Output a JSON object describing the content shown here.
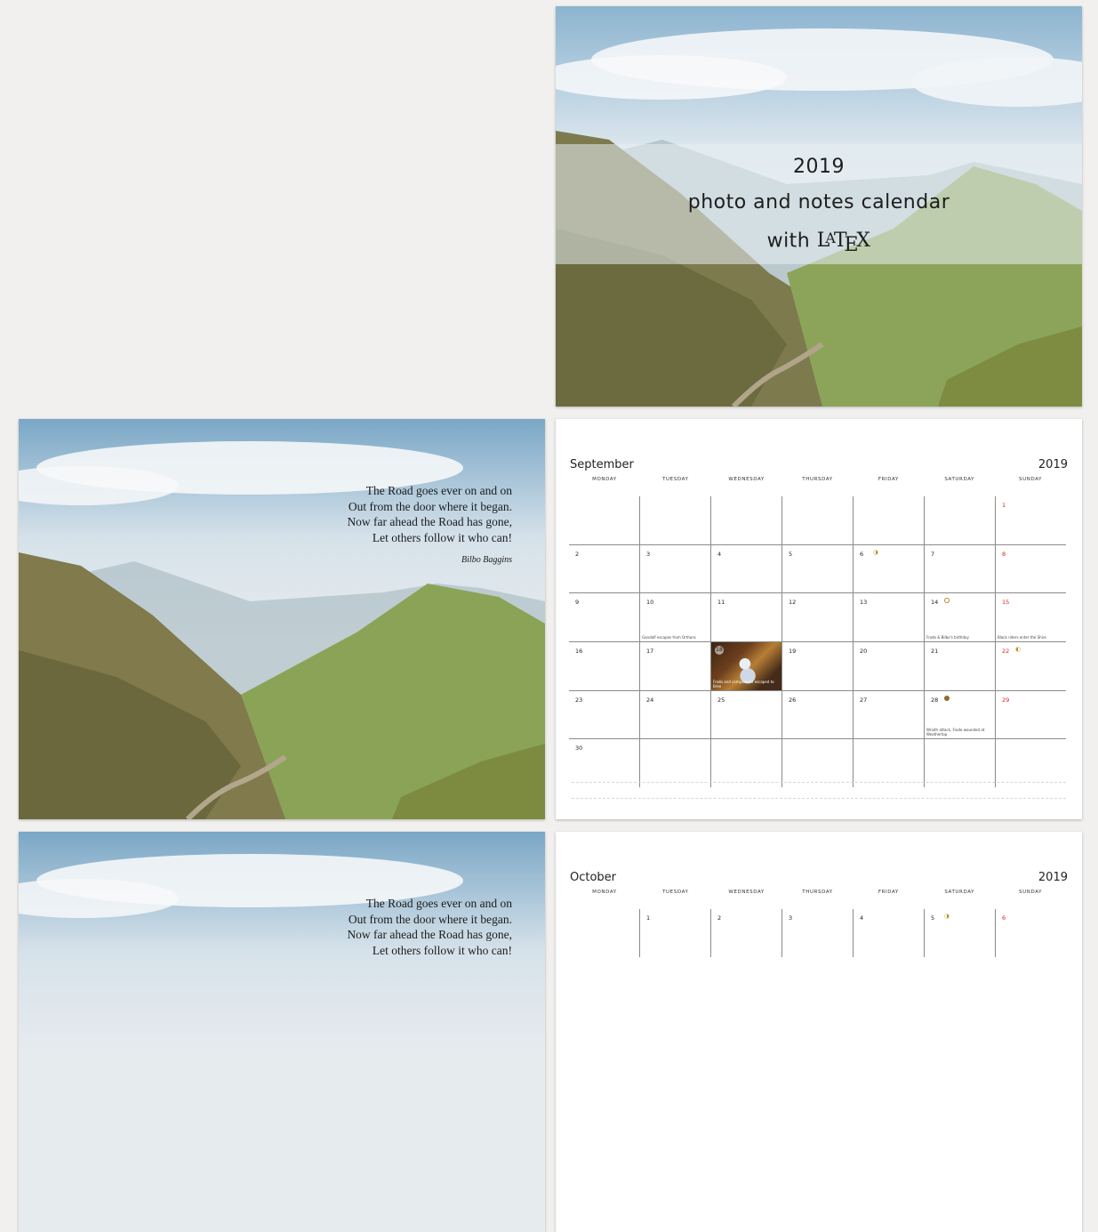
{
  "cover": {
    "year": "2019",
    "subtitle": "photo and notes calendar",
    "with_prefix": "with"
  },
  "poem": {
    "lines": [
      "The Road goes ever on and on",
      "Out from the door where it began.",
      "Now far ahead the Road has gone,",
      "Let others follow it who can!"
    ],
    "author": "Bilbo Baggins"
  },
  "weekdays": [
    "MONDAY",
    "TUESDAY",
    "WEDNESDAY",
    "THURSDAY",
    "FRIDAY",
    "SATURDAY",
    "SUNDAY"
  ],
  "colors": {
    "weekend_red": "#d8231f",
    "moon": "#b8862a",
    "background": "#f1f0ee"
  },
  "september": {
    "month": "September",
    "year": "2019",
    "weeks": [
      [
        "",
        "",
        "",
        "",
        "",
        "",
        "1"
      ],
      [
        "2",
        "3",
        "4",
        "5",
        "6",
        "7",
        "8"
      ],
      [
        "9",
        "10",
        "11",
        "12",
        "13",
        "14",
        "15"
      ],
      [
        "16",
        "17",
        "18",
        "19",
        "20",
        "21",
        "22"
      ],
      [
        "23",
        "24",
        "25",
        "26",
        "27",
        "28",
        "29"
      ],
      [
        "30",
        "",
        "",
        "",
        "",
        "",
        ""
      ]
    ],
    "notes": {
      "10": "Gandalf escapes from Orthanc",
      "14": "Frodo & Bilbo's birthday",
      "15": "Black riders enter the Shire",
      "18": "Frodo and companions escaped to Bree",
      "28": "Wraith attack, Frodo wounded at Weathertop"
    },
    "image_day": "18",
    "moons": {
      "6": "first",
      "14": "full",
      "22": "last",
      "28": "new"
    }
  },
  "october": {
    "month": "October",
    "year": "2019",
    "first_week": [
      "",
      "1",
      "2",
      "3",
      "4",
      "5",
      "6"
    ],
    "moons": {
      "5": "first"
    }
  }
}
